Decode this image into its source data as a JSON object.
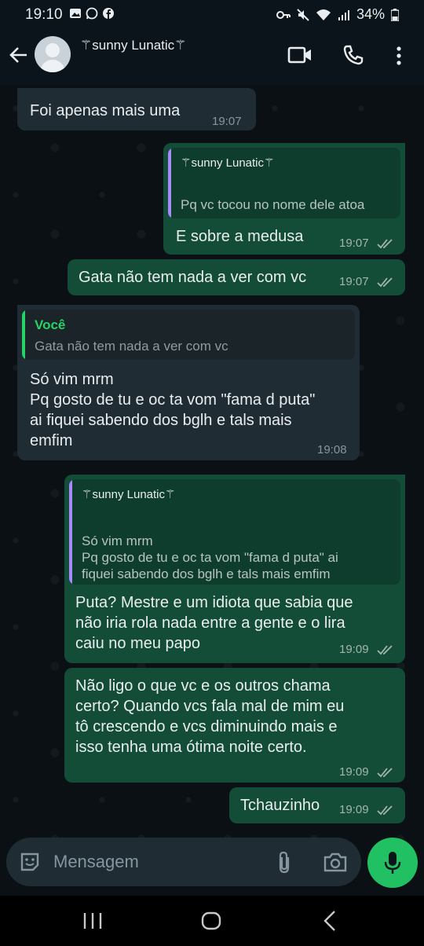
{
  "status_bar": {
    "time": "19:10",
    "battery": "34%"
  },
  "header": {
    "contact_name": "⚚sunny Lunatic⚚"
  },
  "messages": [
    {
      "dir": "in",
      "text": "Foi apenas mais uma",
      "time": "19:07"
    },
    {
      "dir": "out",
      "quote_author": "⚚sunny Lunatic⚚",
      "quote_text": "Pq vc tocou no nome dele atoa",
      "text": "E sobre a medusa",
      "time": "19:07"
    },
    {
      "dir": "out",
      "text": "Gata não tem nada a ver com vc",
      "time": "19:07"
    },
    {
      "dir": "in",
      "quote_author": "Você",
      "quote_text": "Gata não tem nada a ver com vc",
      "text": "Só vim mrm\nPq gosto de tu e oc ta vom \"fama d puta\"\nai fiquei sabendo dos bglh e tals mais\nemfim",
      "time": "19:08"
    },
    {
      "dir": "out",
      "quote_author": "⚚sunny Lunatic⚚",
      "quote_text": "Só vim mrm\nPq gosto de tu e oc ta vom \"fama d puta\" ai\nfiquei sabendo dos bglh e tals mais emfim",
      "text": "Puta? Mestre e um idiota que sabia que\nnão iria rola nada entre a gente e o lira\ncaiu no meu papo",
      "time": "19:09"
    },
    {
      "dir": "out",
      "text": "Não ligo o que vc e os outros chama\ncerto? Quando vcs fala mal de mim eu\ntô crescendo e vcs diminuindo mais e\nisso tenha uma ótima noite certo.",
      "time": "19:09"
    },
    {
      "dir": "out",
      "text": "Tchauzinho",
      "time": "19:09"
    }
  ],
  "input": {
    "placeholder": "Mensagem"
  },
  "colors": {
    "accent": "#21c063",
    "outgoing_bubble": "#144d37",
    "incoming_bubble": "#202c33"
  },
  "icons": [
    "back-arrow-icon",
    "video-call-icon",
    "phone-icon",
    "menu-icon",
    "emoji-icon",
    "attach-icon",
    "camera-icon",
    "mic-icon"
  ]
}
